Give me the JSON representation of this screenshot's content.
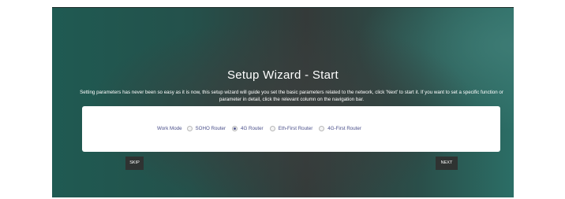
{
  "wizard": {
    "title": "Setup Wizard - Start",
    "description": "Setting parameters has never been so easy as it is now, this setup wizard will guide you set the basic parameters related to the network, click 'Next' to start it. If you want to set a specific function or parameter in detail, click the relevant column on the navigation bar.",
    "work_mode": {
      "label": "Work Mode",
      "selected": "4G Router",
      "options": [
        {
          "label": "SOHO Router",
          "checked": false
        },
        {
          "label": "4G Router",
          "checked": true
        },
        {
          "label": "Eth-First Router",
          "checked": false
        },
        {
          "label": "4G-First Router",
          "checked": false
        }
      ]
    },
    "skip_label": "SKIP",
    "next_label": "NEXT"
  },
  "colors": {
    "background_teal": "#1f5a52",
    "background_dark": "#343a39",
    "button_bg": "#2f3332",
    "option_text": "#4a4f8a"
  }
}
